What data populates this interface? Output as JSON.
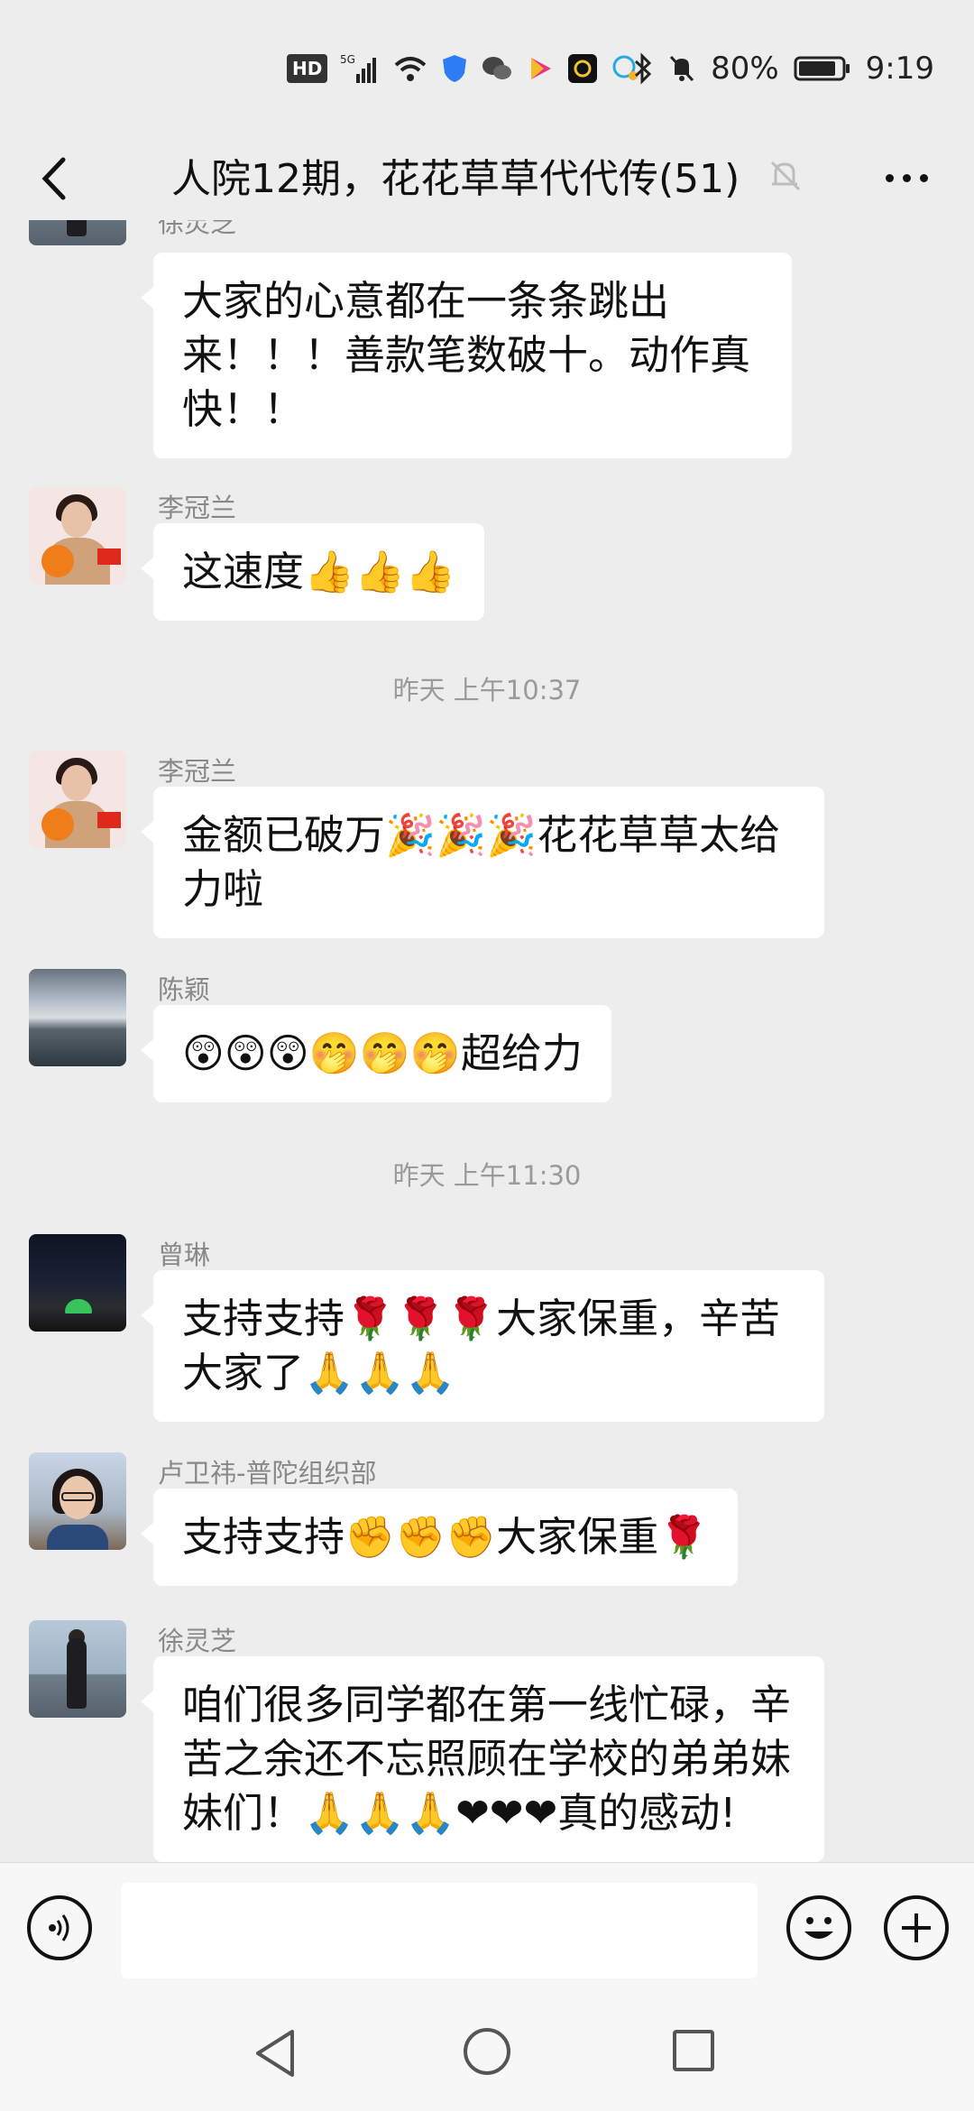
{
  "status_bar": {
    "hd": "HD",
    "signal": "5G",
    "battery": "80%",
    "time": "9:19",
    "icons": [
      "hd-icon",
      "5g-signal-icon",
      "wifi-icon",
      "shield-app-icon",
      "wechat-app-icon",
      "video-app-icon",
      "app-icon",
      "chat-app-icon",
      "bluetooth-icon",
      "mute-bell-icon",
      "battery-icon"
    ]
  },
  "header": {
    "title": "人院12期，花花草草代代传(51)",
    "back_icon": "chevron-left-icon",
    "mute_icon": "bell-off-icon",
    "more_icon": "more-dots-icon"
  },
  "messages": [
    {
      "sender": "徐灵芝",
      "text": "大家的心意都在一条条跳出来！！！善款笔数破十。动作真快！！",
      "lines": [
        "大家的心意都在一条条跳出",
        "来！！！善款笔数破十。动作真",
        "快！！"
      ]
    },
    {
      "sender": "李冠兰",
      "text": "这速度👍👍👍"
    },
    {
      "timestamp": "昨天 上午10:37"
    },
    {
      "sender": "李冠兰",
      "text": "金额已破万🎉🎉🎉花花草草太给力啦",
      "lines": [
        "金额已破万🎉🎉🎉花花草草太给",
        "力啦"
      ]
    },
    {
      "sender": "陈颖",
      "text": "😲😲😲🤭🤭🤭超给力"
    },
    {
      "timestamp": "昨天 上午11:30"
    },
    {
      "sender": "曾琳",
      "text": "支持支持🌹🌹🌹大家保重，辛苦大家了🙏🙏🙏",
      "lines": [
        "支持支持🌹🌹🌹大家保重，辛苦",
        "大家了🙏🙏🙏"
      ]
    },
    {
      "sender": "卢卫祎-普陀组织部",
      "text": "支持支持✊✊✊大家保重🌹"
    },
    {
      "sender": "徐灵芝",
      "text": "咱们很多同学都在第一线忙碌，辛苦之余还不忘照顾在学校的弟弟妹妹们！🙏🙏🙏❤❤❤真的感动!",
      "lines": [
        "咱们很多同学都在第一线忙碌，辛",
        "苦之余还不忘照顾在学校的弟弟妹",
        "妹们！🙏🙏🙏❤❤❤真的感动!"
      ]
    }
  ],
  "input_bar": {
    "placeholder": "",
    "voice_icon": "voice-input-icon",
    "emoji_icon": "emoji-icon",
    "plus_icon": "plus-icon"
  },
  "nav_bar": {
    "icons": [
      "nav-back-icon",
      "nav-home-icon",
      "nav-recent-icon"
    ]
  },
  "colors": {
    "background": "#ededed",
    "bubble": "#ffffff",
    "sender": "#888888",
    "timestamp": "#9a9a9a"
  }
}
